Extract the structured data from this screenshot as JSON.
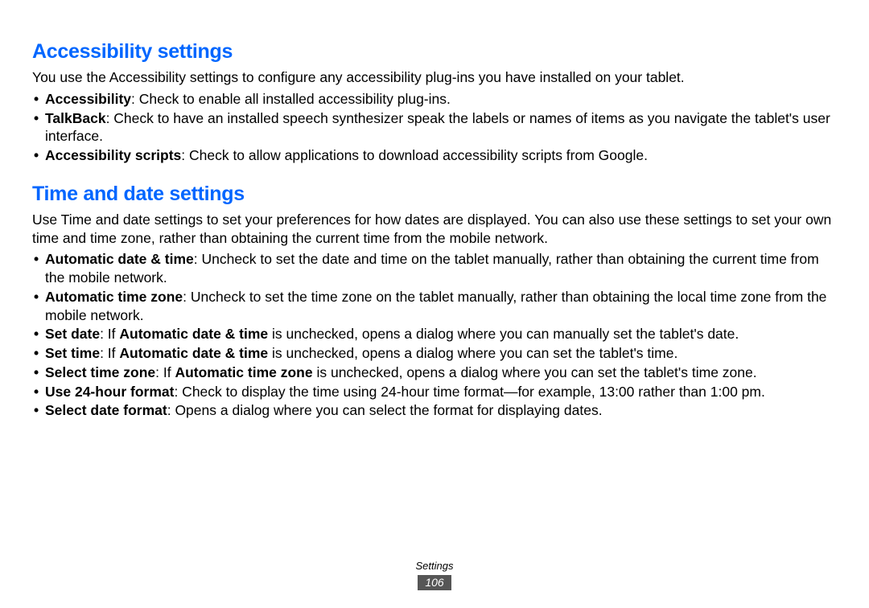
{
  "colors": {
    "heading": "#0066ff",
    "page_badge_bg": "#565656"
  },
  "sections": [
    {
      "heading": "Accessibility settings",
      "intro": "You use the Accessibility settings to configure any accessibility plug-ins you have installed on your tablet.",
      "bullets": [
        {
          "term": "Accessibility",
          "rest": ": Check to enable all installed accessibility plug-ins."
        },
        {
          "term": "TalkBack",
          "rest": ": Check to have an installed speech synthesizer speak the labels or names of items as you navigate the tablet's user interface."
        },
        {
          "term": "Accessibility scripts",
          "rest": ": Check to allow applications to download accessibility scripts from Google."
        }
      ]
    },
    {
      "heading": "Time and date settings",
      "intro": "Use Time and date settings to set your preferences for how dates are displayed. You can also use these settings to set your own time and time zone, rather than obtaining the current time from the mobile network.",
      "bullets": [
        {
          "term": "Automatic date & time",
          "rest": ": Uncheck to set the date and time on the tablet manually, rather than obtaining the current time from the mobile network."
        },
        {
          "term": "Automatic time zone",
          "rest": ": Uncheck to set the time zone on the tablet manually, rather than obtaining the local time zone from the mobile network."
        },
        {
          "term": "Set date",
          "rest_pre": ": If ",
          "inline_bold": "Automatic date & time",
          "rest_post": " is unchecked, opens a dialog where you can manually set the tablet's date."
        },
        {
          "term": "Set time",
          "rest_pre": ": If ",
          "inline_bold": "Automatic date & time",
          "rest_post": " is unchecked, opens a dialog where you can set the tablet's time."
        },
        {
          "term": "Select time zone",
          "rest_pre": ": If ",
          "inline_bold": "Automatic time zone",
          "rest_post": " is unchecked, opens a dialog where you can set the tablet's time zone."
        },
        {
          "term": "Use 24-hour format",
          "rest": ": Check to display the time using 24-hour time format—for example, 13:00 rather than 1:00 pm."
        },
        {
          "term": "Select date format",
          "rest": ": Opens a dialog where you can select the format for displaying dates."
        }
      ]
    }
  ],
  "footer": {
    "label": "Settings",
    "page_number": "106"
  }
}
